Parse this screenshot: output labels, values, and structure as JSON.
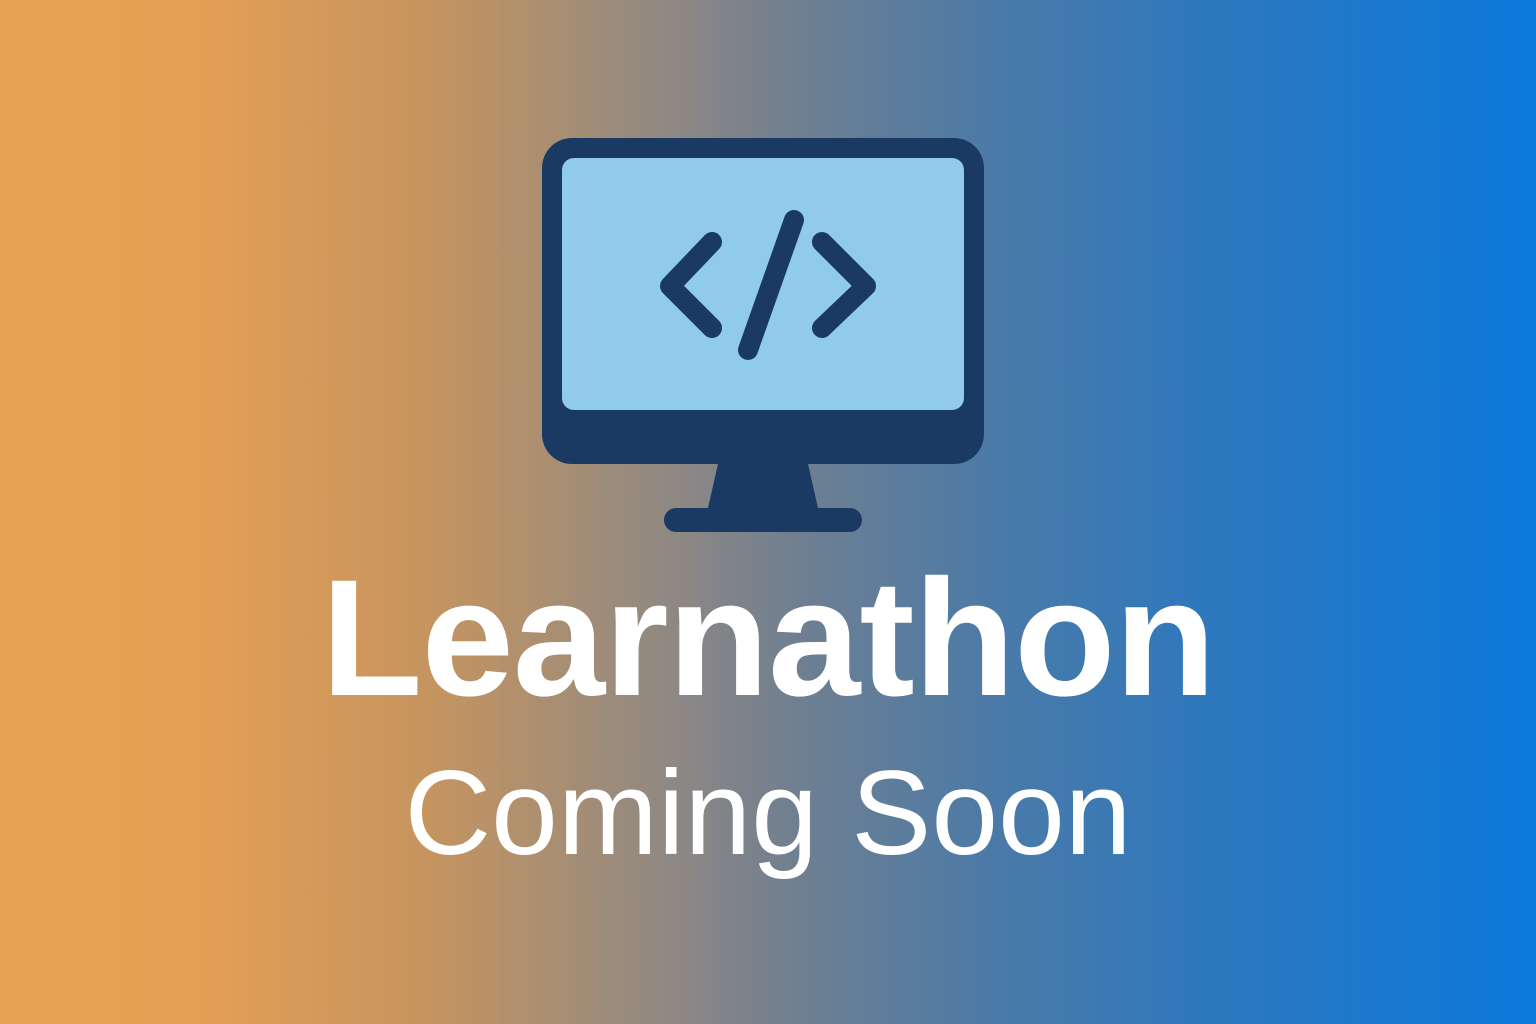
{
  "title": "Learnathon",
  "subtitle": "Coming Soon",
  "icon": {
    "name": "monitor-code-icon",
    "frame_color": "#1b3a63",
    "screen_color": "#90caec",
    "symbol_color": "#1b3a63"
  },
  "background": {
    "gradient_start": "#e8a253",
    "gradient_end": "#0b79dc"
  },
  "text_color": "#ffffff"
}
